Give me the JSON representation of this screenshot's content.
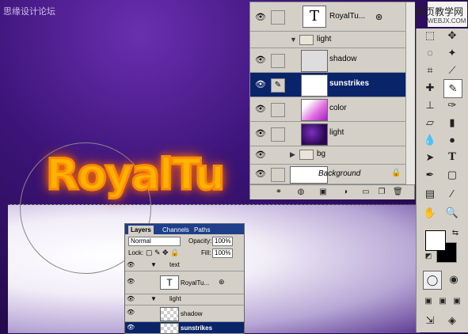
{
  "watermark_left": "思缘设计论坛",
  "watermark_right": {
    "line1": "网页教学网",
    "line2": "WEBJX.COM"
  },
  "canvas": {
    "logo_text": "RoyalTu"
  },
  "layers_panel": {
    "layers": [
      {
        "kind": "text",
        "name": "RoyalTu..."
      },
      {
        "kind": "group",
        "name": "light",
        "expanded": true
      },
      {
        "kind": "layer",
        "name": "shadow"
      },
      {
        "kind": "layer",
        "name": "sunstrikes",
        "selected": true
      },
      {
        "kind": "layer",
        "name": "color"
      },
      {
        "kind": "layer",
        "name": "light"
      },
      {
        "kind": "group",
        "name": "bg",
        "expanded": false
      },
      {
        "kind": "layer",
        "name": "Background"
      }
    ]
  },
  "small_layers_panel": {
    "tabs": [
      "Layers",
      "Channels",
      "Paths"
    ],
    "blend_mode": "Normal",
    "opacity_label": "Opacity:",
    "opacity_value": "100%",
    "lock_label": "Lock:",
    "fill_label": "Fill:",
    "fill_value": "100%",
    "rows": [
      {
        "kind": "group",
        "name": "text"
      },
      {
        "kind": "text",
        "name": "RoyalTu..."
      },
      {
        "kind": "group",
        "name": "light"
      },
      {
        "kind": "layer",
        "name": "shadow"
      },
      {
        "kind": "layer",
        "name": "sunstrikes",
        "selected": true
      }
    ]
  },
  "colors": {
    "accent": "#0a246a",
    "logo": "#ffb400",
    "panel": "#d4d0c8"
  }
}
